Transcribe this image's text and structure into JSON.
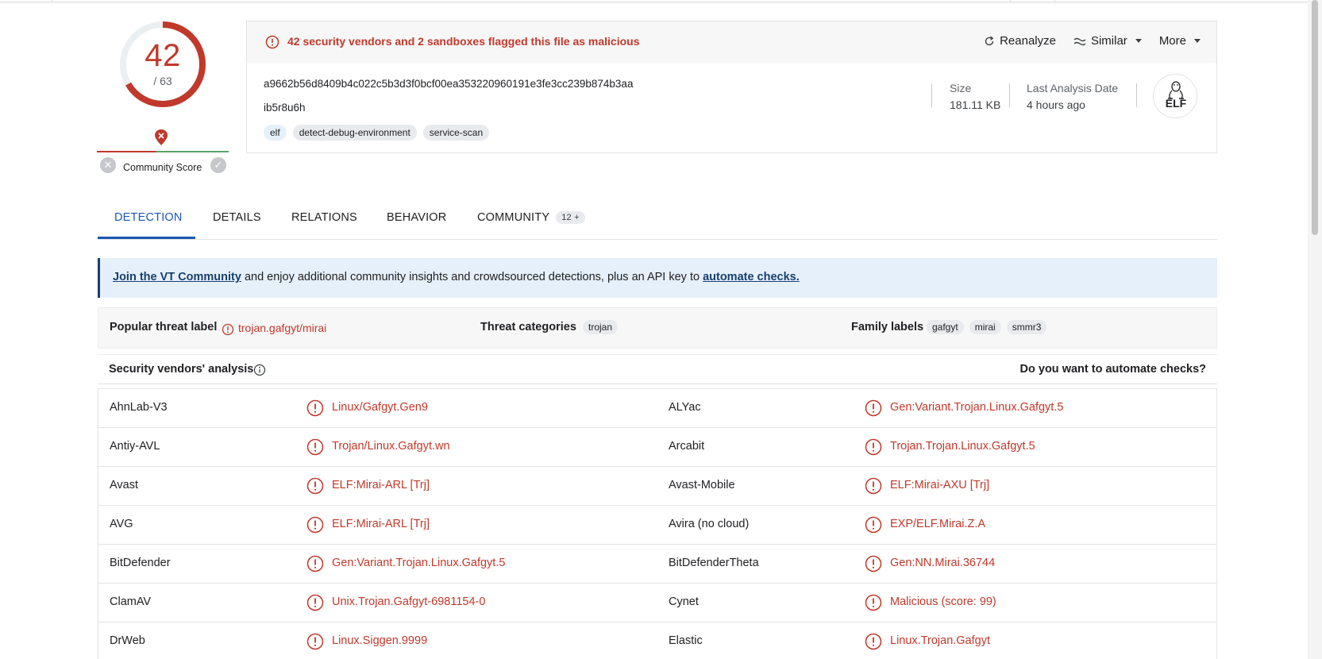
{
  "score": {
    "detections": "42",
    "total": "/ 63"
  },
  "community": {
    "label": "Community Score"
  },
  "alert": {
    "text": "42 security vendors and 2 sandboxes flagged this file as malicious"
  },
  "actions": {
    "reanalyze": "Reanalyze",
    "similar": "Similar",
    "more": "More"
  },
  "file": {
    "hash": "a9662b56d8409b4c022c5b3d3f0bcf00ea353220960191e3fe3cc239b874b3aa",
    "name": "ib5r8u6h",
    "tags": [
      "elf",
      "detect-debug-environment",
      "service-scan"
    ],
    "size_label": "Size",
    "size_value": "181.11 KB",
    "last_label": "Last Analysis Date",
    "last_value": "4 hours ago",
    "type_badge": "ELF"
  },
  "tabs": [
    {
      "label": "DETECTION"
    },
    {
      "label": "DETAILS"
    },
    {
      "label": "RELATIONS"
    },
    {
      "label": "BEHAVIOR"
    },
    {
      "label": "COMMUNITY",
      "count": "12 +"
    }
  ],
  "banner": {
    "link1": "Join the VT Community",
    "middle": " and enjoy additional community insights and crowdsourced detections, plus an API key to ",
    "link2": "automate checks."
  },
  "threat": {
    "popular_label": "Popular threat label",
    "popular_value": "trojan.gafgyt/mirai",
    "categories_label": "Threat categories",
    "categories": [
      "trojan"
    ],
    "family_label": "Family labels",
    "families": [
      "gafgyt",
      "mirai",
      "smmr3"
    ]
  },
  "vendors": {
    "title": "Security vendors' analysis",
    "automate": "Do you want to automate checks?",
    "rows": [
      {
        "v1": "AhnLab-V3",
        "r1": "Linux/Gafgyt.Gen9",
        "v2": "ALYac",
        "r2": "Gen:Variant.Trojan.Linux.Gafgyt.5"
      },
      {
        "v1": "Antiy-AVL",
        "r1": "Trojan/Linux.Gafgyt.wn",
        "v2": "Arcabit",
        "r2": "Trojan.Trojan.Linux.Gafgyt.5"
      },
      {
        "v1": "Avast",
        "r1": "ELF:Mirai-ARL [Trj]",
        "v2": "Avast-Mobile",
        "r2": "ELF:Mirai-AXU [Trj]"
      },
      {
        "v1": "AVG",
        "r1": "ELF:Mirai-ARL [Trj]",
        "v2": "Avira (no cloud)",
        "r2": "EXP/ELF.Mirai.Z.A"
      },
      {
        "v1": "BitDefender",
        "r1": "Gen:Variant.Trojan.Linux.Gafgyt.5",
        "v2": "BitDefenderTheta",
        "r2": "Gen:NN.Mirai.36744"
      },
      {
        "v1": "ClamAV",
        "r1": "Unix.Trojan.Gafgyt-6981154-0",
        "v2": "Cynet",
        "r2": "Malicious (score: 99)"
      },
      {
        "v1": "DrWeb",
        "r1": "Linux.Siggen.9999",
        "v2": "Elastic",
        "r2": "Linux.Trojan.Gafgyt"
      }
    ]
  },
  "colors": {
    "malicious": "#c0392b",
    "accent": "#1a57b6",
    "banner_bg": "#e6f0fa"
  }
}
